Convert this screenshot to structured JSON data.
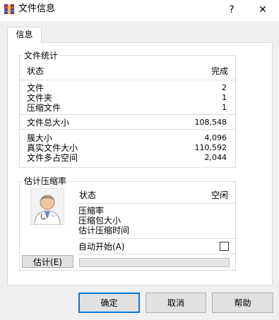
{
  "window": {
    "title": "文件信息"
  },
  "titlebar": {
    "help": "?",
    "close": "✕"
  },
  "tab": {
    "label": "信息"
  },
  "file_stats": {
    "title": "文件统计",
    "status_label": "状态",
    "status_value": "完成",
    "files_label": "文件",
    "files_value": "2",
    "folders_label": "文件夹",
    "folders_value": "1",
    "archives_label": "压缩文件",
    "archives_value": "1",
    "total_size_label": "文件总大小",
    "total_size_value": "108,548",
    "cluster_label": "簇大小",
    "cluster_value": "4,096",
    "real_size_label": "真实文件大小",
    "real_size_value": "110,592",
    "overhead_label": "文件多占空间",
    "overhead_value": "2,044"
  },
  "estimate": {
    "title": "估计压缩率",
    "status_label": "状态",
    "status_value": "空闲",
    "ratio_label": "压缩率",
    "size_label": "压缩包大小",
    "time_label": "估计压缩时间",
    "auto_start_label": "自动开始(A)",
    "auto_start_checked": false,
    "estimate_button": "估计(E)",
    "progress": 0
  },
  "buttons": {
    "ok": "确定",
    "cancel": "取消",
    "help": "帮助"
  }
}
